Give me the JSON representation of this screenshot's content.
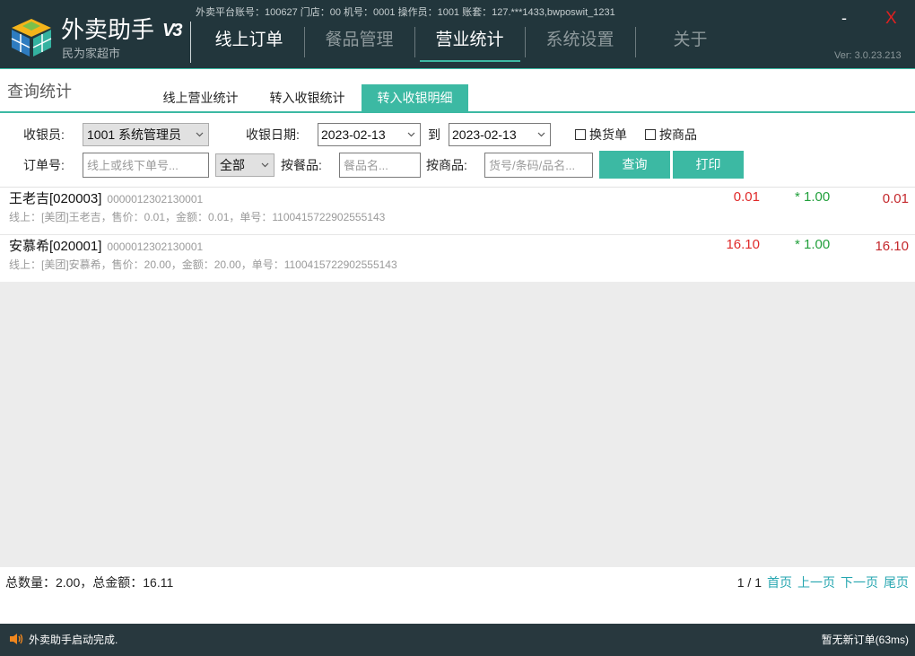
{
  "theme": {
    "header_bg": "#22363c",
    "accent": "#3cb9a3",
    "status_bg": "#28383e",
    "price_red": "#e02a2a",
    "amount_red": "#c4282c",
    "qty_green": "#22a03c",
    "link_teal": "#26a6b0",
    "close_red": "#e02020",
    "alert_orange": "#f0871e"
  },
  "icons": {
    "logo": "app-logo-icon",
    "dropdown": "chevron-down-icon",
    "checkbox": "checkbox-icon",
    "status": "speaker-icon"
  },
  "window": {
    "account_info": "外卖平台账号：100627 门店：00 机号：0001 操作员：1001 账套：127.***1433,bwposwit_1231",
    "app_title": "外卖助手",
    "app_badge": "V3",
    "store_name": "民为家超市",
    "minimize_label": "-",
    "close_label": "X",
    "version": "Ver: 3.0.23.213"
  },
  "nav": [
    {
      "label": "线上订单",
      "active": false
    },
    {
      "label": "餐品管理",
      "active": false
    },
    {
      "label": "营业统计",
      "active": true
    },
    {
      "label": "系统设置",
      "active": false
    },
    {
      "label": "关于",
      "active": false
    }
  ],
  "section_title": "查询统计",
  "subtabs": [
    {
      "label": "线上营业统计",
      "active": false
    },
    {
      "label": "转入收银统计",
      "active": false
    },
    {
      "label": "转入收银明细",
      "active": true
    }
  ],
  "filters": {
    "cashier_label": "收银员:",
    "cashier_value": "1001 系统管理员",
    "date_label": "收银日期:",
    "date_from": "2023-02-13",
    "date_to_label": "到",
    "date_to": "2023-02-13",
    "checkbox_exchange": {
      "label": "换货单",
      "checked": false
    },
    "checkbox_by_product": {
      "label": "按商品",
      "checked": false
    },
    "order_label": "订单号:",
    "order_placeholder": "线上或线下单号...",
    "type_value": "全部",
    "dish_label": "按餐品:",
    "dish_placeholder": "餐品名...",
    "product_label": "按商品:",
    "product_placeholder": "货号/条码/品名...",
    "query_button": "查询",
    "print_button": "打印"
  },
  "rows": [
    {
      "name": "王老吉[020003]",
      "code": "0000012302130001",
      "detail": "线上：[美团]王老吉，售价：0.01，金额：0.01，单号：1100415722902555143",
      "price": "0.01",
      "qty": "* 1.00",
      "amount": "0.01"
    },
    {
      "name": "安慕希[020001]",
      "code": "0000012302130001",
      "detail": "线上：[美团]安慕希，售价：20.00，金额：20.00，单号：1100415722902555143",
      "price": "16.10",
      "qty": "* 1.00",
      "amount": "16.10"
    }
  ],
  "footer": {
    "summary": "总数量：2.00，总金额：16.11",
    "page_count": "1 / 1",
    "first": "首页",
    "prev": "上一页",
    "next": "下一页",
    "last": "尾页"
  },
  "status": {
    "message": "外卖助手启动完成.",
    "order_status": "暂无新订单(63ms)"
  }
}
